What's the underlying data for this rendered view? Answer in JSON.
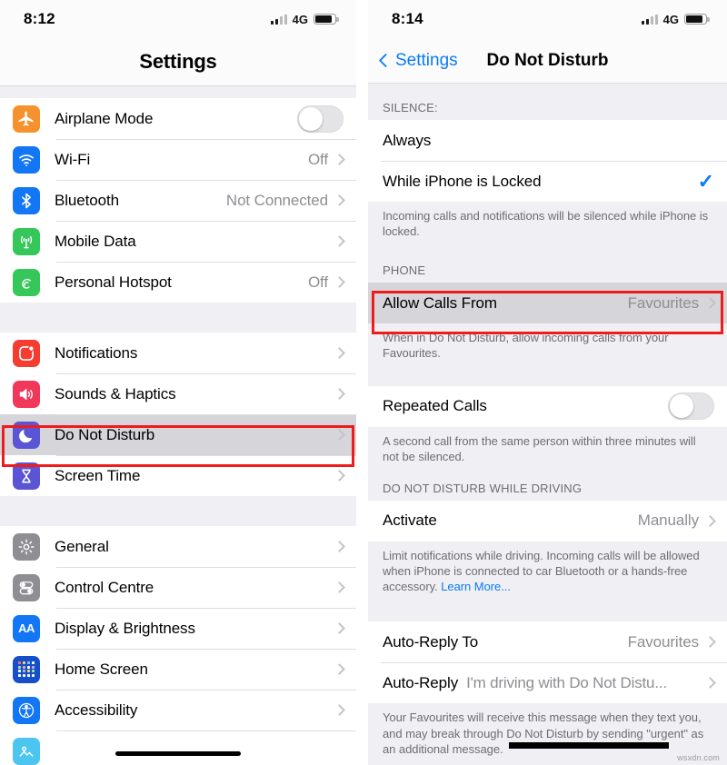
{
  "left": {
    "status": {
      "time": "8:12",
      "network": "4G",
      "signal_bars_filled": 2,
      "battery_pct": 88
    },
    "nav": {
      "title": "Settings"
    },
    "groups": [
      {
        "rows": [
          {
            "label": "Airplane Mode",
            "icon": "airplane-icon",
            "color": "#f5922d",
            "accessory": "toggle",
            "toggle_on": false
          },
          {
            "label": "Wi-Fi",
            "icon": "wifi-icon",
            "color": "#1376f4",
            "accessory": "chevron",
            "value": "Off"
          },
          {
            "label": "Bluetooth",
            "icon": "bluetooth-icon",
            "color": "#1376f4",
            "accessory": "chevron",
            "value": "Not Connected"
          },
          {
            "label": "Mobile Data",
            "icon": "cellular-icon",
            "color": "#35c759",
            "accessory": "chevron",
            "value": ""
          },
          {
            "label": "Personal Hotspot",
            "icon": "hotspot-icon",
            "color": "#35c759",
            "accessory": "chevron",
            "value": "Off"
          }
        ]
      },
      {
        "rows": [
          {
            "label": "Notifications",
            "icon": "notifications-icon",
            "color": "#f53c30",
            "accessory": "chevron",
            "value": ""
          },
          {
            "label": "Sounds & Haptics",
            "icon": "sounds-icon",
            "color": "#f2385a",
            "accessory": "chevron",
            "value": ""
          },
          {
            "label": "Do Not Disturb",
            "icon": "moon-icon",
            "color": "#5955d4",
            "accessory": "chevron",
            "value": "",
            "selected": true
          },
          {
            "label": "Screen Time",
            "icon": "hourglass-icon",
            "color": "#5955d4",
            "accessory": "chevron",
            "value": ""
          }
        ]
      },
      {
        "rows": [
          {
            "label": "General",
            "icon": "gear-icon",
            "color": "#8e8e93",
            "accessory": "chevron",
            "value": ""
          },
          {
            "label": "Control Centre",
            "icon": "control-centre-icon",
            "color": "#8e8e93",
            "accessory": "chevron",
            "value": ""
          },
          {
            "label": "Display & Brightness",
            "icon": "display-brightness-icon",
            "color": "#1376f4",
            "accessory": "chevron",
            "value": ""
          },
          {
            "label": "Home Screen",
            "icon": "home-screen-icon",
            "color": "#1550c8",
            "accessory": "chevron",
            "value": ""
          },
          {
            "label": "Accessibility",
            "icon": "accessibility-icon",
            "color": "#1376f4",
            "accessory": "chevron",
            "value": ""
          },
          {
            "label": "",
            "icon": "wallpaper-icon",
            "color": "#4cc5f0",
            "accessory": "none",
            "value": ""
          }
        ]
      }
    ],
    "highlight": "Do Not Disturb"
  },
  "right": {
    "status": {
      "time": "8:14",
      "network": "4G",
      "signal_bars_filled": 2,
      "battery_pct": 88
    },
    "nav": {
      "back_label": "Settings",
      "title": "Do Not Disturb"
    },
    "sections": [
      {
        "header": "SILENCE:",
        "rows": [
          {
            "label": "Always",
            "accessory": "none"
          },
          {
            "label": "While iPhone is Locked",
            "accessory": "check"
          }
        ],
        "footnote": "Incoming calls and notifications will be silenced while iPhone is locked."
      },
      {
        "header": "PHONE",
        "rows": [
          {
            "label": "Allow Calls From",
            "value": "Favourites",
            "accessory": "chevron",
            "selected": true
          }
        ],
        "footnote": "When in Do Not Disturb, allow incoming calls from your Favourites."
      },
      {
        "header": "",
        "rows": [
          {
            "label": "Repeated Calls",
            "accessory": "toggle",
            "toggle_on": false
          }
        ],
        "footnote": "A second call from the same person within three minutes will not be silenced."
      },
      {
        "header": "DO NOT DISTURB WHILE DRIVING",
        "rows": [
          {
            "label": "Activate",
            "value": "Manually",
            "accessory": "chevron"
          }
        ],
        "footnote": "Limit notifications while driving. Incoming calls will be allowed when iPhone is connected to car Bluetooth or a hands-free accessory. ",
        "footnote_link": "Learn More..."
      },
      {
        "header": "",
        "rows": [
          {
            "label": "Auto-Reply To",
            "value": "Favourites",
            "accessory": "chevron"
          },
          {
            "label": "Auto-Reply",
            "sub_value": "I'm driving with Do Not Distu...",
            "accessory": "chevron"
          }
        ],
        "footnote": "Your Favourites will receive this message when they text you, and may break through Do Not Disturb by sending \"urgent\" as an additional message."
      }
    ],
    "highlight": "Allow Calls From",
    "watermark": "wsxdn.com"
  }
}
